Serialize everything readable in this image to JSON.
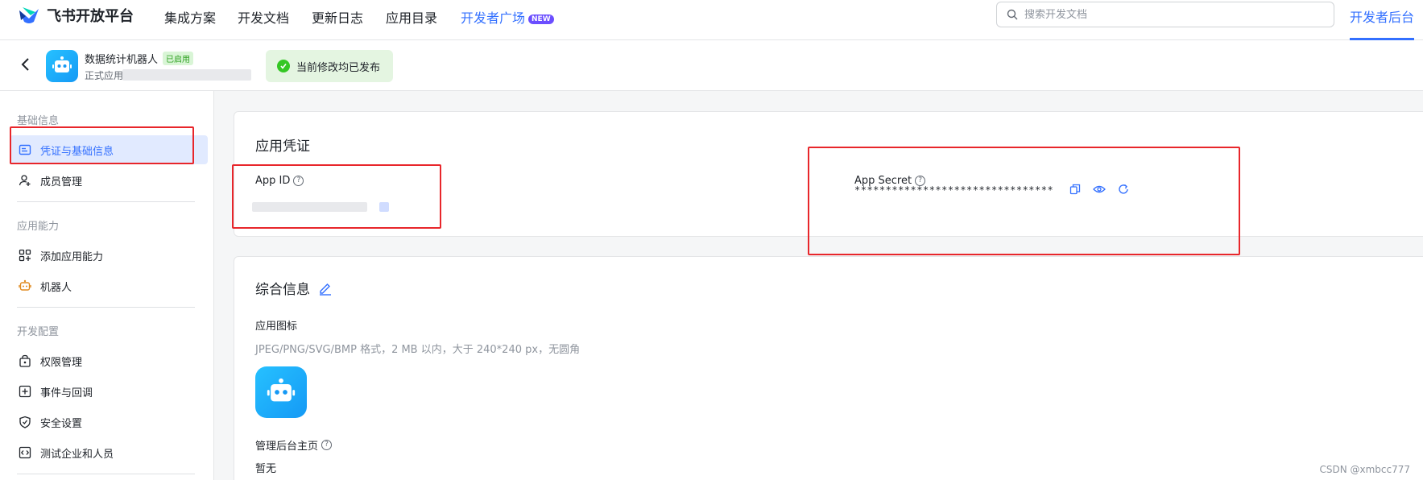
{
  "topnav": {
    "brand": "飞书开放平台",
    "items": [
      "集成方案",
      "开发文档",
      "更新日志",
      "应用目录",
      "开发者广场"
    ],
    "new_badge": "NEW",
    "search_placeholder": "搜索开发文档",
    "console": "开发者后台"
  },
  "app": {
    "name": "数据统计机器人",
    "status": "已启用",
    "type": "正式应用",
    "toast": "当前修改均已发布"
  },
  "sidebar": {
    "sections": [
      {
        "title": "基础信息",
        "items": [
          {
            "label": "凭证与基础信息",
            "icon": "credential-icon",
            "active": true
          },
          {
            "label": "成员管理",
            "icon": "member-icon"
          }
        ]
      },
      {
        "title": "应用能力",
        "items": [
          {
            "label": "添加应用能力",
            "icon": "grid-add-icon"
          },
          {
            "label": "机器人",
            "icon": "robot-icon"
          }
        ]
      },
      {
        "title": "开发配置",
        "items": [
          {
            "label": "权限管理",
            "icon": "lock-icon"
          },
          {
            "label": "事件与回调",
            "icon": "event-icon"
          },
          {
            "label": "安全设置",
            "icon": "shield-icon"
          },
          {
            "label": "测试企业和人员",
            "icon": "code-icon"
          }
        ]
      }
    ]
  },
  "credentials": {
    "title": "应用凭证",
    "app_id_label": "App ID",
    "app_secret_label": "App Secret",
    "app_secret_value": "********************************"
  },
  "general": {
    "title": "综合信息",
    "icon_label": "应用图标",
    "icon_hint": "JPEG/PNG/SVG/BMP 格式，2 MB 以内，大于 240*240 px，无圆角",
    "homepage_label": "管理后台主页",
    "homepage_value": "暂无"
  },
  "watermark": "CSDN @xmbcc777",
  "colors": {
    "accent": "#3370ff",
    "highlight_box": "#e8262b",
    "success": "#34c724"
  }
}
